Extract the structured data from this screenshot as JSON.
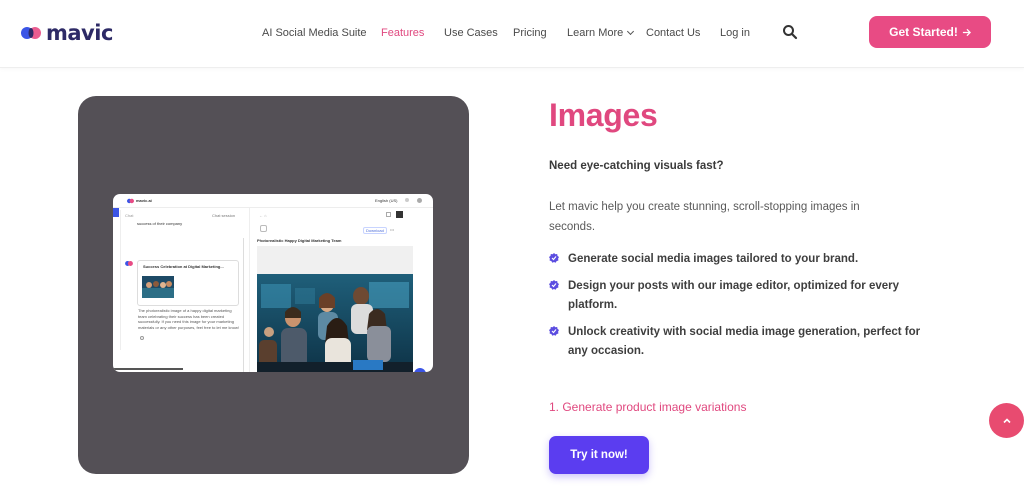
{
  "header": {
    "logo_text": "mavic",
    "nav": [
      {
        "label": "AI Social Media Suite",
        "active": false
      },
      {
        "label": "Features",
        "active": true
      },
      {
        "label": "Use Cases",
        "active": false
      },
      {
        "label": "Pricing",
        "active": false
      },
      {
        "label": "Learn More",
        "active": false,
        "dropdown": true
      },
      {
        "label": "Contact Us",
        "active": false
      },
      {
        "label": "Log in",
        "active": false
      }
    ],
    "search_icon": "search-icon",
    "cta_label": "Get Started!",
    "cta_icon": "arrow-right-icon"
  },
  "preview": {
    "app_name": "mavic.ai",
    "language": "English (US)",
    "chat_label": "Chat",
    "chat_history_label": "Chat session",
    "context_text": "success of their company",
    "card_title": "Success Celebration at Digital Marketing...",
    "message": "The photorealistic image of a happy digital marketing team celebrating their success has been created successfully. If you need this image for your marketing materials or any other purposes, feel free to let me know!",
    "download_label": "Download",
    "image_caption": "Photorealistic Happy Digital Marketing Team"
  },
  "content": {
    "title": "Images",
    "subtitle": "Need eye-catching visuals fast?",
    "description": "Let mavic help you create stunning, scroll-stopping images in seconds.",
    "features": [
      "Generate social media images tailored to your brand.",
      "Design your posts with our image editor, optimized for every platform.",
      "Unlock creativity with social media image generation, perfect for any occasion."
    ],
    "link_label": "1. Generate product image variations",
    "try_label": "Try it now!"
  },
  "colors": {
    "accent_pink": "#e0487f",
    "cta_pink": "#e84b84",
    "purple": "#5b3df0",
    "card_gray": "#545056",
    "logo_navy": "#2d2a66"
  }
}
